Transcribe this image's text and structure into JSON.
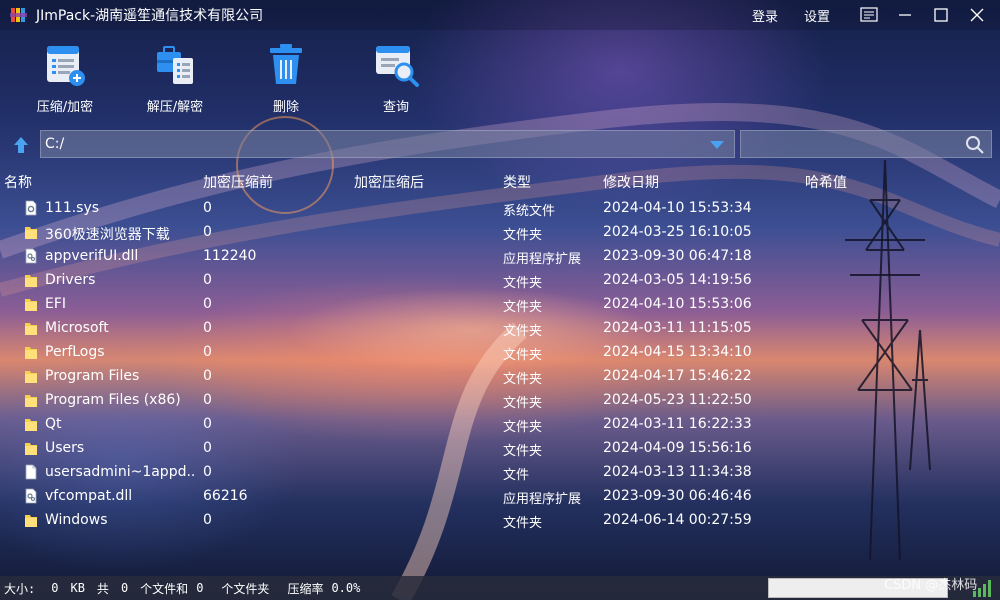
{
  "app": {
    "title": "JImPack-湖南遥笙通信技术有限公司",
    "login": "登录",
    "settings": "设置"
  },
  "toolbar": [
    {
      "label": "压缩/加密",
      "icon": "compress-encrypt-icon"
    },
    {
      "label": "解压/解密",
      "icon": "decompress-decrypt-icon"
    },
    {
      "label": "删除",
      "icon": "trash-icon"
    },
    {
      "label": "查询",
      "icon": "query-search-icon"
    }
  ],
  "path": {
    "value": "C:/"
  },
  "search": {
    "value": "",
    "placeholder": ""
  },
  "columns": [
    "名称",
    "加密压缩前",
    "加密压缩后",
    "类型",
    "修改日期",
    "哈希值"
  ],
  "rows": [
    {
      "name": "111.sys",
      "enc": "0",
      "dec": "",
      "type": "系统文件",
      "date": "2024-04-10 15:53:34",
      "hash": "",
      "icon": "system-file-icon"
    },
    {
      "name": "360极速浏览器下载",
      "enc": "0",
      "dec": "",
      "type": "文件夹",
      "date": "2024-03-25 16:10:05",
      "hash": "",
      "icon": "folder-icon"
    },
    {
      "name": "appverifUI.dll",
      "enc": "112240",
      "dec": "",
      "type": "应用程序扩展",
      "date": "2023-09-30 06:47:18",
      "hash": "",
      "icon": "dll-file-icon"
    },
    {
      "name": "Drivers",
      "enc": "0",
      "dec": "",
      "type": "文件夹",
      "date": "2024-03-05 14:19:56",
      "hash": "",
      "icon": "folder-icon"
    },
    {
      "name": "EFI",
      "enc": "0",
      "dec": "",
      "type": "文件夹",
      "date": "2024-04-10 15:53:06",
      "hash": "",
      "icon": "folder-icon"
    },
    {
      "name": "Microsoft",
      "enc": "0",
      "dec": "",
      "type": "文件夹",
      "date": "2024-03-11 11:15:05",
      "hash": "",
      "icon": "folder-icon"
    },
    {
      "name": "PerfLogs",
      "enc": "0",
      "dec": "",
      "type": "文件夹",
      "date": "2024-04-15 13:34:10",
      "hash": "",
      "icon": "folder-icon"
    },
    {
      "name": "Program Files",
      "enc": "0",
      "dec": "",
      "type": "文件夹",
      "date": "2024-04-17 15:46:22",
      "hash": "",
      "icon": "folder-icon"
    },
    {
      "name": "Program Files (x86)",
      "enc": "0",
      "dec": "",
      "type": "文件夹",
      "date": "2024-05-23 11:22:50",
      "hash": "",
      "icon": "folder-icon"
    },
    {
      "name": "Qt",
      "enc": "0",
      "dec": "",
      "type": "文件夹",
      "date": "2024-03-11 16:22:33",
      "hash": "",
      "icon": "folder-icon"
    },
    {
      "name": "Users",
      "enc": "0",
      "dec": "",
      "type": "文件夹",
      "date": "2024-04-09 15:56:16",
      "hash": "",
      "icon": "folder-icon"
    },
    {
      "name": "usersadmini~1appd...",
      "enc": "0",
      "dec": "",
      "type": "文件",
      "date": "2024-03-13 11:34:38",
      "hash": "",
      "icon": "file-icon"
    },
    {
      "name": "vfcompat.dll",
      "enc": "66216",
      "dec": "",
      "type": "应用程序扩展",
      "date": "2023-09-30 06:46:46",
      "hash": "",
      "icon": "dll-file-icon"
    },
    {
      "name": "Windows",
      "enc": "0",
      "dec": "",
      "type": "文件夹",
      "date": "2024-06-14 00:27:59",
      "hash": "",
      "icon": "folder-icon"
    }
  ],
  "status": {
    "size_label": "大小:",
    "size_value": "0",
    "size_unit": "KB",
    "total_label": "共",
    "files_count": "0",
    "files_label": "个文件和",
    "folders_count": "0",
    "folders_label": "个文件夹",
    "ratio_label": "压缩率",
    "ratio_value": "0.0%",
    "progress": 0
  },
  "watermark": "CSDN @杰林码",
  "colors": {
    "folder": "#f5d04f",
    "accent": "#4aa3f0",
    "progress_fill": "#5cb85c"
  }
}
